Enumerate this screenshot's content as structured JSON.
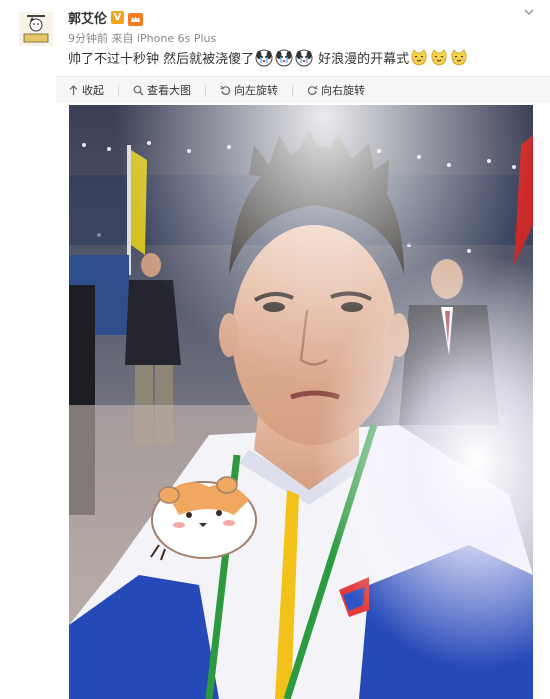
{
  "header": {
    "username": "郭艾伦",
    "verified_badge": "V",
    "meta_time": "9分钟前",
    "meta_source": "来自 iPhone 6s Plus",
    "post_segments": {
      "part1": "帅了不过十秒钟 然后就被浇傻了",
      "part2": "好浪漫的开幕式"
    },
    "emoji_group1": [
      "crying-dog-emoji",
      "crying-dog-emoji",
      "crying-dog-emoji"
    ],
    "emoji_group2": [
      "smiling-cat-emoji",
      "smiling-cat-emoji",
      "smiling-cat-emoji"
    ]
  },
  "toolbar": {
    "collapse_label": "收起",
    "view_large_label": "查看大图",
    "rotate_left_label": "向左旋转",
    "rotate_right_label": "向右旋转"
  },
  "colors": {
    "accent": "#f2a31f",
    "toolbar_bg": "#f6f6f6",
    "meta_text": "#888888"
  }
}
